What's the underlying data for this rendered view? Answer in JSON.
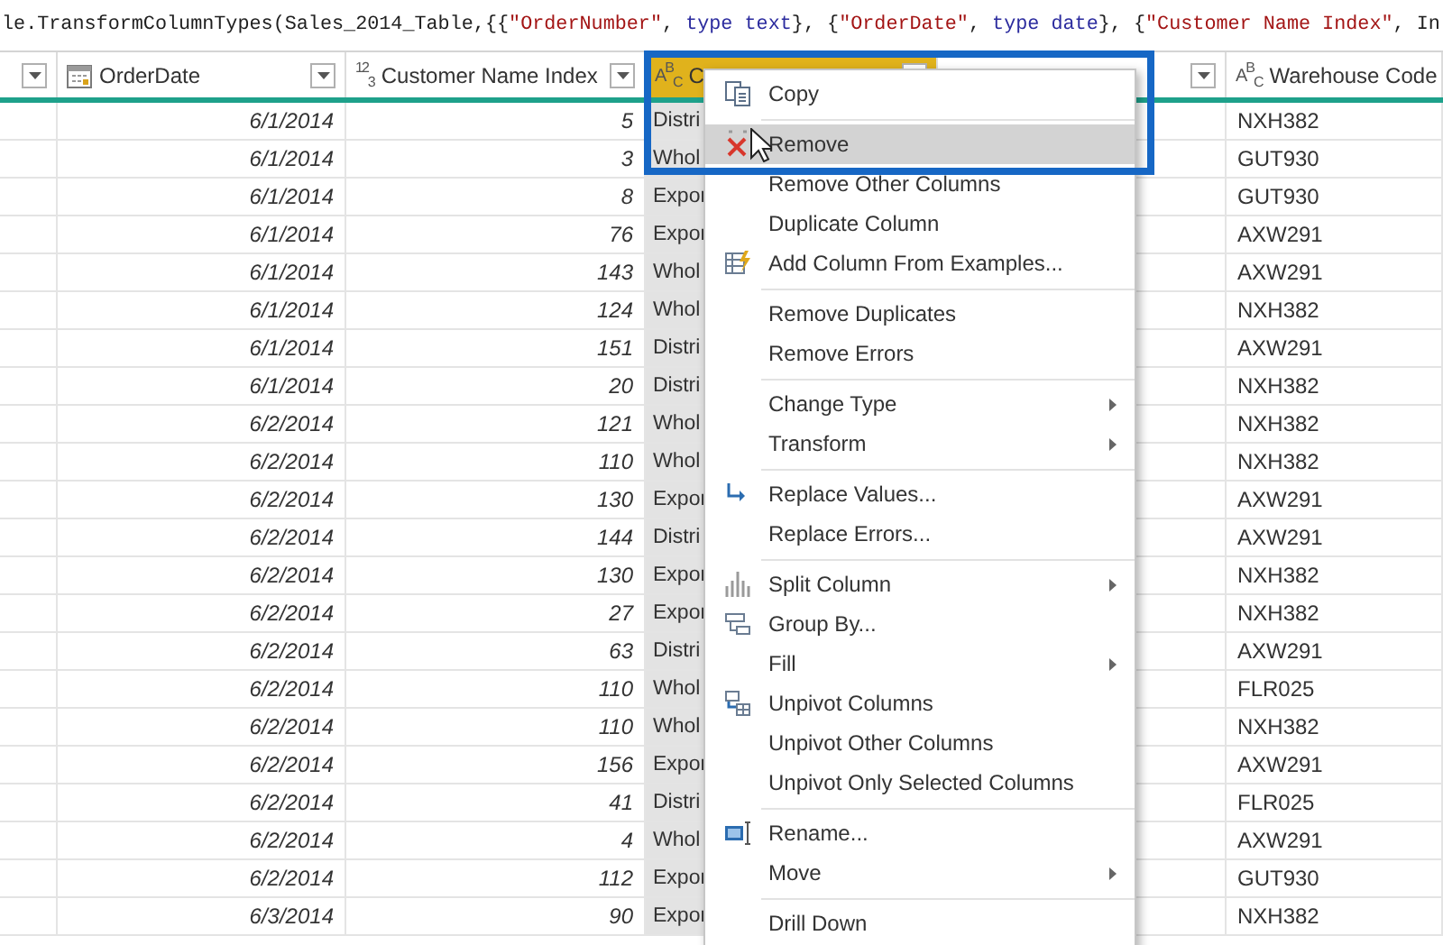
{
  "formula_bar": {
    "segments": [
      {
        "kind": "plain",
        "text": "le.TransformColumnTypes(Sales_2014_Table,{{"
      },
      {
        "kind": "string",
        "text": "\"OrderNumber\""
      },
      {
        "kind": "plain",
        "text": ", "
      },
      {
        "kind": "keyword",
        "text": "type text"
      },
      {
        "kind": "plain",
        "text": "}, {"
      },
      {
        "kind": "string",
        "text": "\"OrderDate\""
      },
      {
        "kind": "plain",
        "text": ", "
      },
      {
        "kind": "keyword",
        "text": "type date"
      },
      {
        "kind": "plain",
        "text": "}, {"
      },
      {
        "kind": "string",
        "text": "\"Customer Name Index\""
      },
      {
        "kind": "plain",
        "text": ", In"
      }
    ]
  },
  "table": {
    "columns": [
      {
        "selected": false
      },
      {
        "label": "OrderDate",
        "selected": false
      },
      {
        "type_icon": "$^{1}$$^{2}$$_{3}$",
        "label": "Customer Name Index",
        "selected": false
      },
      {
        "type_icon": "A$^{B}$$_{C}$",
        "label": "C",
        "selected": true
      },
      {
        "selected": false
      },
      {
        "type_icon": "A$^{B}$$_{C}$",
        "label": "Warehouse Code",
        "selected": false
      }
    ],
    "rows": [
      {
        "order_date": "6/1/2014",
        "customer_name_index": "5",
        "column_4": "Distri",
        "warehouse_code": "NXH382"
      },
      {
        "order_date": "6/1/2014",
        "customer_name_index": "3",
        "column_4": "Whol",
        "warehouse_code": "GUT930"
      },
      {
        "order_date": "6/1/2014",
        "customer_name_index": "8",
        "column_4": "Expor",
        "warehouse_code": "GUT930"
      },
      {
        "order_date": "6/1/2014",
        "customer_name_index": "76",
        "column_4": "Expor",
        "warehouse_code": "AXW291"
      },
      {
        "order_date": "6/1/2014",
        "customer_name_index": "143",
        "column_4": "Whol",
        "warehouse_code": "AXW291"
      },
      {
        "order_date": "6/1/2014",
        "customer_name_index": "124",
        "column_4": "Whol",
        "warehouse_code": "NXH382"
      },
      {
        "order_date": "6/1/2014",
        "customer_name_index": "151",
        "column_4": "Distri",
        "warehouse_code": "AXW291"
      },
      {
        "order_date": "6/1/2014",
        "customer_name_index": "20",
        "column_4": "Distri",
        "warehouse_code": "NXH382"
      },
      {
        "order_date": "6/2/2014",
        "customer_name_index": "121",
        "column_4": "Whol",
        "warehouse_code": "NXH382"
      },
      {
        "order_date": "6/2/2014",
        "customer_name_index": "110",
        "column_4": "Whol",
        "warehouse_code": "NXH382"
      },
      {
        "order_date": "6/2/2014",
        "customer_name_index": "130",
        "column_4": "Expor",
        "warehouse_code": "AXW291"
      },
      {
        "order_date": "6/2/2014",
        "customer_name_index": "144",
        "column_4": "Distri",
        "warehouse_code": "AXW291"
      },
      {
        "order_date": "6/2/2014",
        "customer_name_index": "130",
        "column_4": "Expor",
        "warehouse_code": "NXH382"
      },
      {
        "order_date": "6/2/2014",
        "customer_name_index": "27",
        "column_4": "Expor",
        "warehouse_code": "NXH382"
      },
      {
        "order_date": "6/2/2014",
        "customer_name_index": "63",
        "column_4": "Distri",
        "warehouse_code": "AXW291"
      },
      {
        "order_date": "6/2/2014",
        "customer_name_index": "110",
        "column_4": "Whol",
        "warehouse_code": "FLR025"
      },
      {
        "order_date": "6/2/2014",
        "customer_name_index": "110",
        "column_4": "Whol",
        "warehouse_code": "NXH382"
      },
      {
        "order_date": "6/2/2014",
        "customer_name_index": "156",
        "column_4": "Expor",
        "warehouse_code": "AXW291"
      },
      {
        "order_date": "6/2/2014",
        "customer_name_index": "41",
        "column_4": "Distri",
        "warehouse_code": "FLR025"
      },
      {
        "order_date": "6/2/2014",
        "customer_name_index": "4",
        "column_4": "Whol",
        "warehouse_code": "AXW291"
      },
      {
        "order_date": "6/2/2014",
        "customer_name_index": "112",
        "column_4": "Expor",
        "warehouse_code": "GUT930"
      },
      {
        "order_date": "6/3/2014",
        "customer_name_index": "90",
        "column_4": "Expor",
        "warehouse_code": "NXH382"
      }
    ]
  },
  "context_menu": {
    "items": [
      {
        "kind": "item",
        "label": "Copy",
        "has_submenu": false,
        "selected": false
      },
      {
        "kind": "separator"
      },
      {
        "kind": "item",
        "label": "Remove",
        "has_submenu": false,
        "selected": true
      },
      {
        "kind": "item",
        "label": "Remove Other Columns",
        "has_submenu": false,
        "selected": false
      },
      {
        "kind": "item",
        "label": "Duplicate Column",
        "has_submenu": false,
        "selected": false
      },
      {
        "kind": "item",
        "label": "Add Column From Examples...",
        "has_submenu": false,
        "selected": false
      },
      {
        "kind": "separator"
      },
      {
        "kind": "item",
        "label": "Remove Duplicates",
        "has_submenu": false,
        "selected": false
      },
      {
        "kind": "item",
        "label": "Remove Errors",
        "has_submenu": false,
        "selected": false
      },
      {
        "kind": "separator"
      },
      {
        "kind": "item",
        "label": "Change Type",
        "has_submenu": true,
        "selected": false
      },
      {
        "kind": "item",
        "label": "Transform",
        "has_submenu": true,
        "selected": false
      },
      {
        "kind": "separator"
      },
      {
        "kind": "item",
        "label": "Replace Values...",
        "has_submenu": false,
        "selected": false
      },
      {
        "kind": "item",
        "label": "Replace Errors...",
        "has_submenu": false,
        "selected": false
      },
      {
        "kind": "separator"
      },
      {
        "kind": "item",
        "label": "Split Column",
        "has_submenu": true,
        "selected": false
      },
      {
        "kind": "item",
        "label": "Group By...",
        "has_submenu": false,
        "selected": false
      },
      {
        "kind": "item",
        "label": "Fill",
        "has_submenu": true,
        "selected": false
      },
      {
        "kind": "item",
        "label": "Unpivot Columns",
        "has_submenu": false,
        "selected": false
      },
      {
        "kind": "item",
        "label": "Unpivot Other Columns",
        "has_submenu": false,
        "selected": false
      },
      {
        "kind": "item",
        "label": "Unpivot Only Selected Columns",
        "has_submenu": false,
        "selected": false
      },
      {
        "kind": "separator"
      },
      {
        "kind": "item",
        "label": "Rename...",
        "has_submenu": false,
        "selected": false
      },
      {
        "kind": "item",
        "label": "Move",
        "has_submenu": true,
        "selected": false
      },
      {
        "kind": "separator"
      },
      {
        "kind": "item",
        "label": "Drill Down",
        "has_submenu": false,
        "selected": false
      }
    ]
  }
}
